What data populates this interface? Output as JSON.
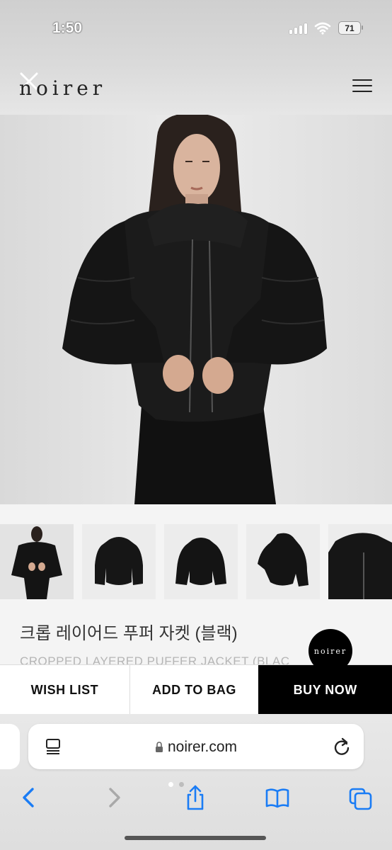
{
  "status_bar": {
    "time": "1:50",
    "battery": "71"
  },
  "header": {
    "logo": "noirer",
    "close_icon": "close-icon",
    "menu_icon": "hamburger-menu-icon"
  },
  "product": {
    "title_ko": "크롭 레이어드 푸퍼 자켓 (블랙)",
    "title_en": "CROPPED LAYERED PUFFER JACKET (BLAC",
    "thumbnails": [
      "model-front",
      "jacket-front",
      "jacket-front-flat",
      "jacket-side",
      "jacket-detail"
    ]
  },
  "badge": {
    "label": "noirer"
  },
  "actions": {
    "wish_list": "WISH LIST",
    "add_to_bag": "ADD TO BAG",
    "buy_now": "BUY NOW"
  },
  "browser": {
    "url": "noirer.com",
    "icons": [
      "reader-icon",
      "lock-icon",
      "reload-icon",
      "back-icon",
      "forward-icon",
      "share-icon",
      "bookmarks-icon",
      "tabs-icon"
    ]
  },
  "colors": {
    "accent": "#000000",
    "ios_blue": "#1a7cf5"
  }
}
